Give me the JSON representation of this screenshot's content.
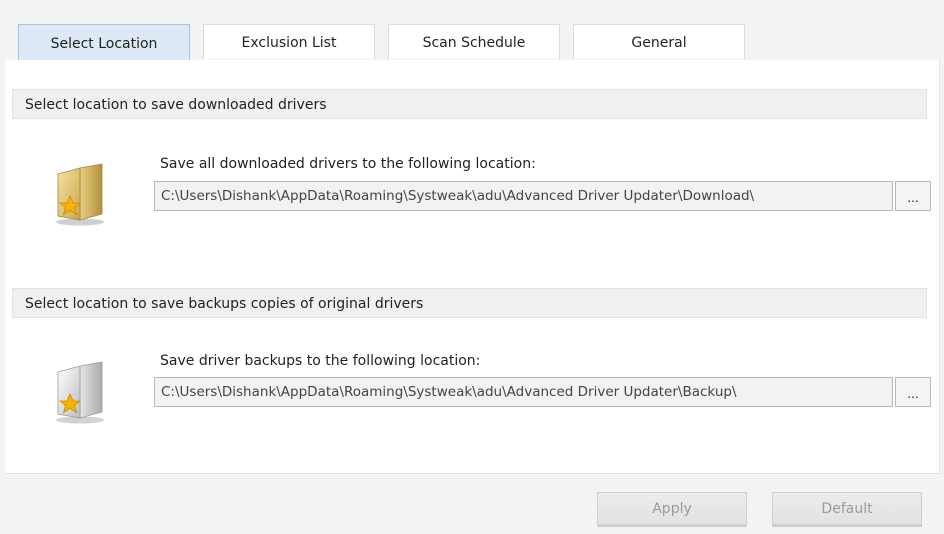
{
  "tabs": [
    {
      "label": "Select Location"
    },
    {
      "label": "Exclusion List"
    },
    {
      "label": "Scan Schedule"
    },
    {
      "label": "General"
    }
  ],
  "download_section": {
    "header": "Select location to save downloaded drivers",
    "prompt": "Save all downloaded drivers to the following location:",
    "path": "C:\\Users\\Dishank\\AppData\\Roaming\\Systweak\\adu\\Advanced Driver Updater\\Download\\",
    "browse_label": "...",
    "icon": "folder-star-icon"
  },
  "backup_section": {
    "header": "Select location to save backups copies of original drivers",
    "prompt": "Save driver backups to the following location:",
    "path": "C:\\Users\\Dishank\\AppData\\Roaming\\Systweak\\adu\\Advanced Driver Updater\\Backup\\",
    "browse_label": "...",
    "icon": "document-star-icon"
  },
  "buttons": {
    "apply": "Apply",
    "default": "Default"
  },
  "colors": {
    "active_tab_bg": "#dde9f4",
    "active_tab_border": "#9ec4e8",
    "disabled_text": "#9a9a9a"
  }
}
